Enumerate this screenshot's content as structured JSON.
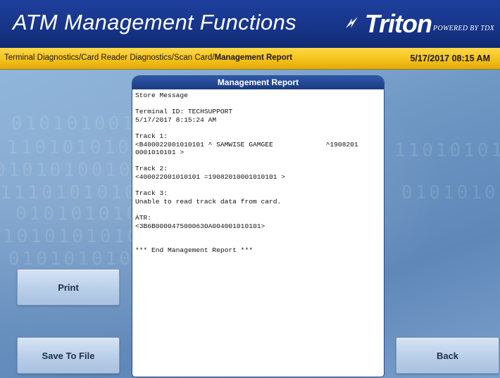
{
  "header": {
    "title": "ATM Management Functions",
    "brand": "Triton",
    "brand_sub": "POWERED BY TDX"
  },
  "breadcrumb": {
    "path": "Terminal Diagnostics/Card Reader Diagnostics/Scan Card/",
    "current": "Management Report",
    "datetime": "5/17/2017  08:15 AM"
  },
  "report": {
    "title": "Management Report",
    "text": "Store Message\n\nTerminal ID: TECHSUPPORT\n5/17/2017 8:15:24 AM\n\nTrack 1:\n<B400022001010101 ^ SAMWISE GAMGEE             ^1908201\n0001010101 >\n\nTrack 2:\n<400022001010101 =19082010001010101 >\n\nTrack 3:\nUnable to read track data from card.\n\nATR:\n<3B6B0000475000630A004001010101>\n\n\n*** End Management Report ***"
  },
  "buttons": {
    "print": "Print",
    "save": "Save To File",
    "back": "Back"
  },
  "background_binary": [
    "0101010010",
    "1101010101",
    "0101010010",
    "1110101010",
    "0101010101",
    "1010101010",
    "0101010101"
  ],
  "colors": {
    "header_bg": "#163487",
    "crumb_bg": "#f4c21a",
    "button_bg": "#b9cee8",
    "panel_title_bg": "#2148a0"
  }
}
